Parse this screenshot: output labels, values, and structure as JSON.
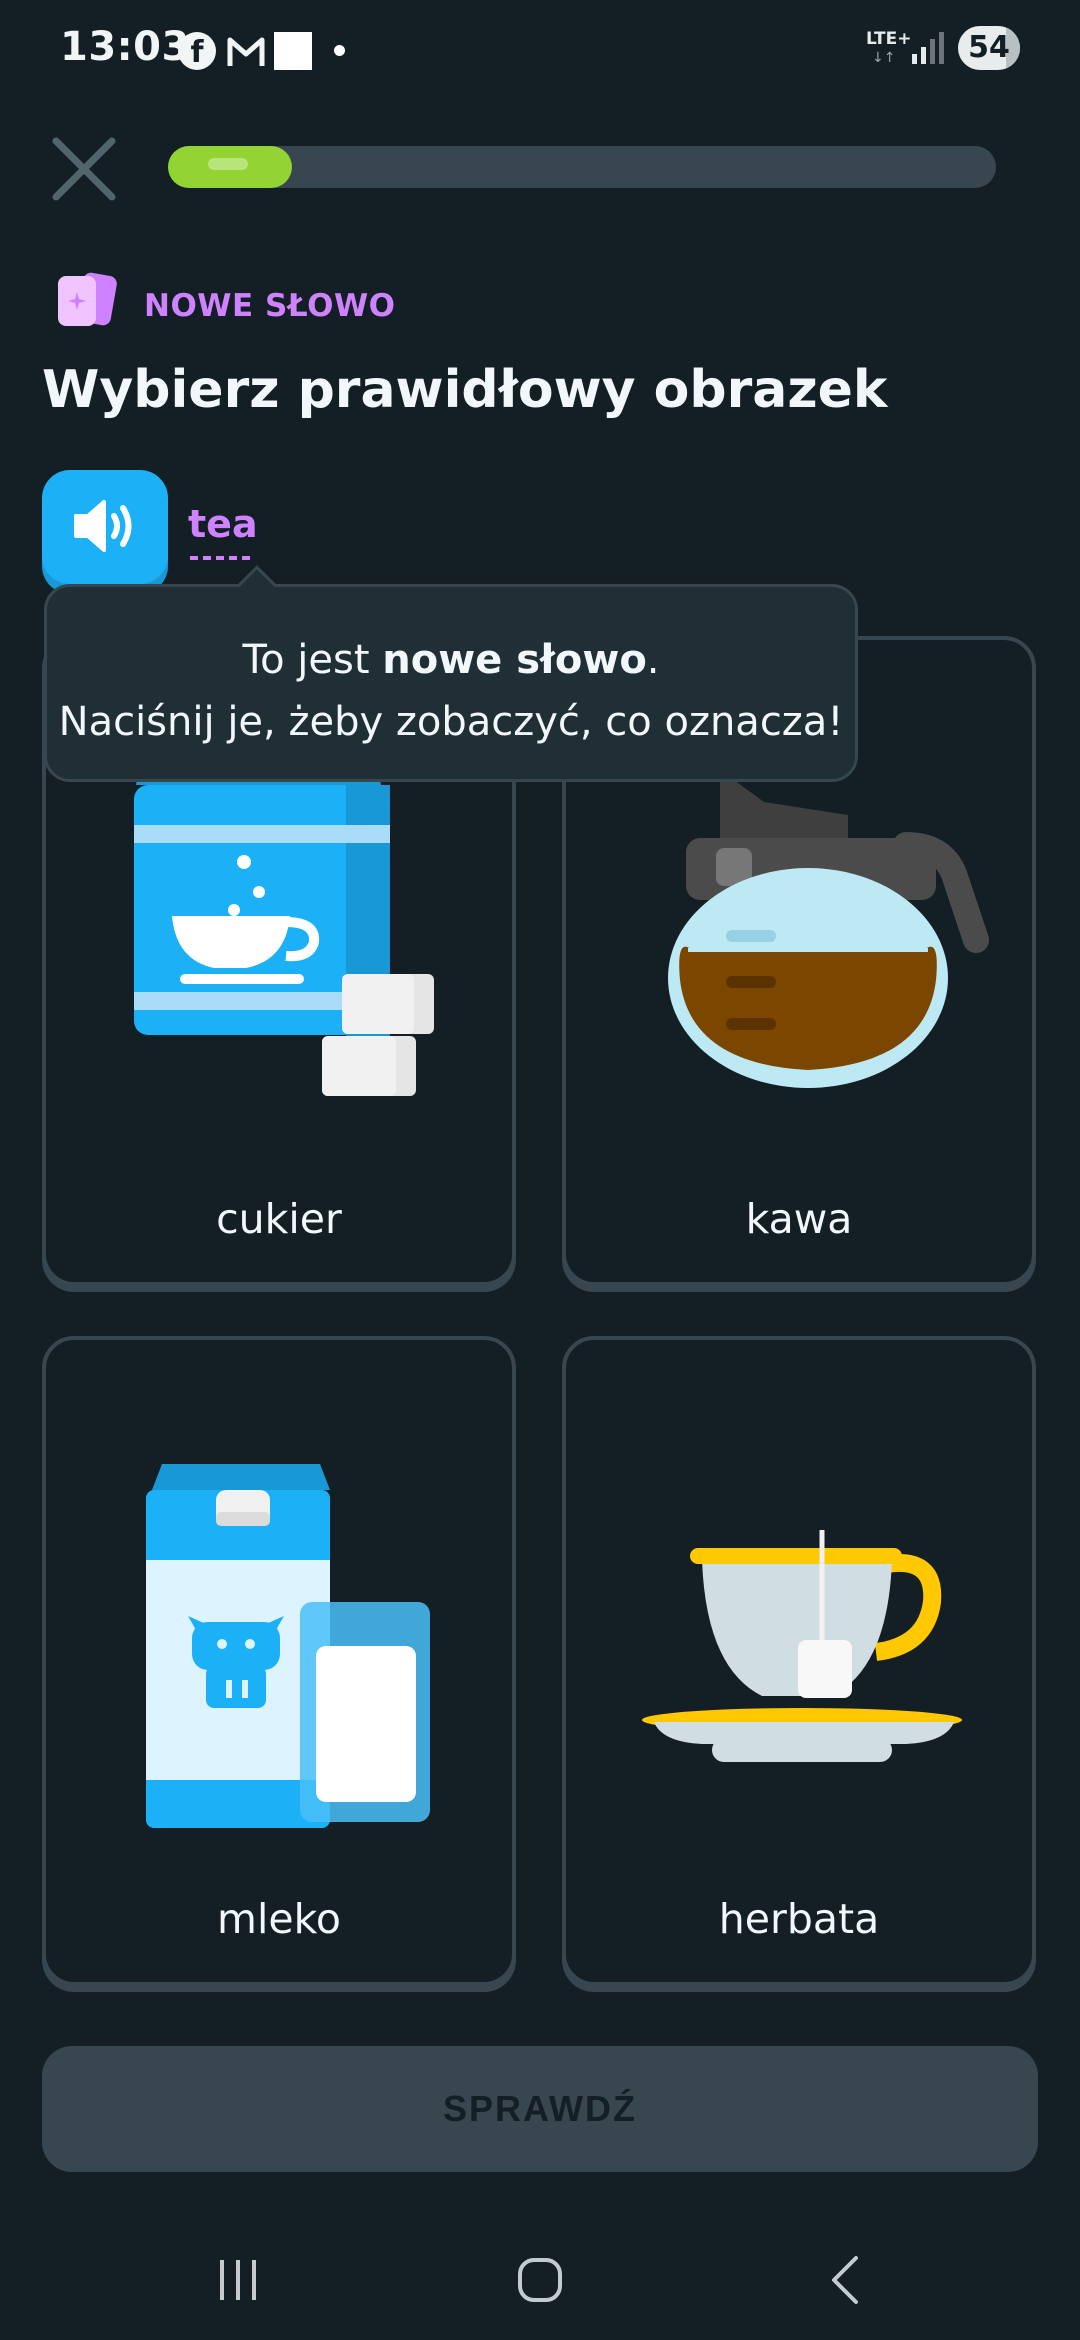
{
  "status_bar": {
    "time": "13:03",
    "network": "LTE+",
    "battery": "54",
    "icons": [
      "facebook-icon",
      "gmail-icon",
      "notification-dot",
      "signal-icon",
      "battery-icon"
    ]
  },
  "header": {
    "close_icon": "close-icon",
    "progress_fraction": 0.15,
    "progress_color": "#93d333"
  },
  "badge": {
    "label": "NOWE SŁOWO",
    "color": "#ce82ff"
  },
  "title": "Wybierz prawidłowy obrazek",
  "prompt": {
    "word": "tea",
    "speaker_icon": "speaker-icon"
  },
  "tooltip": {
    "line1_prefix": "To jest ",
    "line1_bold": "nowe słowo",
    "line1_suffix": ".",
    "line2": "Naciśnij je, żeby zobaczyć, co oznacza!"
  },
  "options": [
    {
      "label": "cukier",
      "icon": "sugar-icon"
    },
    {
      "label": "kawa",
      "icon": "coffee-pot-icon"
    },
    {
      "label": "mleko",
      "icon": "milk-icon"
    },
    {
      "label": "herbata",
      "icon": "tea-cup-icon"
    }
  ],
  "check_button": {
    "label": "SPRAWDŹ"
  },
  "nav": {
    "icons": [
      "recent-apps-icon",
      "home-icon",
      "back-icon"
    ]
  },
  "colors": {
    "background": "#131f24",
    "card_border": "#37464f",
    "accent_blue": "#1cb0f6",
    "accent_purple": "#ce82ff"
  }
}
